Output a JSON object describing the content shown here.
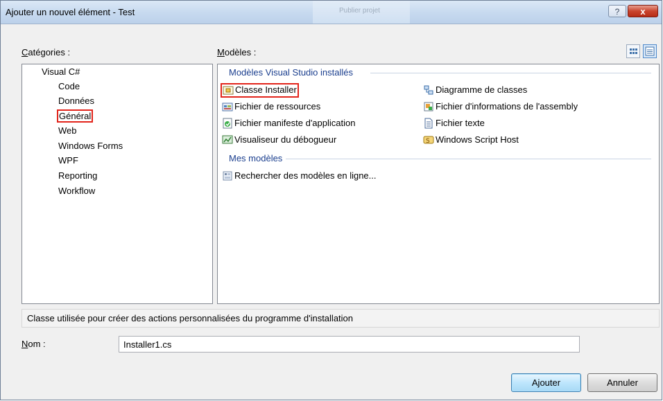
{
  "window": {
    "title": "Ajouter un nouvel élément - Test",
    "ghost_title": "Publier projet",
    "help_label": "?",
    "close_label": "x"
  },
  "categories": {
    "label_accel": "C",
    "label_rest": "atégories :",
    "items": [
      "Visual C#",
      "Code",
      "Données",
      "Général",
      "Web",
      "Windows Forms",
      "WPF",
      "Reporting",
      "Workflow"
    ],
    "selected": "Général"
  },
  "templates": {
    "label_accel": "M",
    "label_rest": "odèles :",
    "group_installed": "Modèles Visual Studio installés",
    "installed_items": [
      {
        "label": "Classe Installer",
        "icon": "installer-class-icon",
        "selected": true
      },
      {
        "label": "Diagramme de classes",
        "icon": "class-diagram-icon"
      },
      {
        "label": "Fichier de ressources",
        "icon": "resource-file-icon"
      },
      {
        "label": "Fichier d'informations de l'assembly",
        "icon": "assembly-info-icon"
      },
      {
        "label": "Fichier manifeste d'application",
        "icon": "app-manifest-icon"
      },
      {
        "label": "Fichier texte",
        "icon": "text-file-icon"
      },
      {
        "label": "Visualiseur du débogueur",
        "icon": "debugger-visualizer-icon"
      },
      {
        "label": "Windows Script Host",
        "icon": "script-host-icon"
      }
    ],
    "group_mine": "Mes modèles",
    "mine_items": [
      {
        "label": "Rechercher des modèles en ligne...",
        "icon": "search-online-icon"
      }
    ]
  },
  "description": "Classe utilisée pour créer des actions personnalisées du programme d'installation",
  "name_field": {
    "label_accel": "N",
    "label_rest": "om :",
    "value": "Installer1.cs"
  },
  "buttons": {
    "add": "Ajouter",
    "cancel": "Annuler"
  },
  "colors": {
    "highlight_box": "#e2231a",
    "group_header": "#1a3e8e"
  }
}
